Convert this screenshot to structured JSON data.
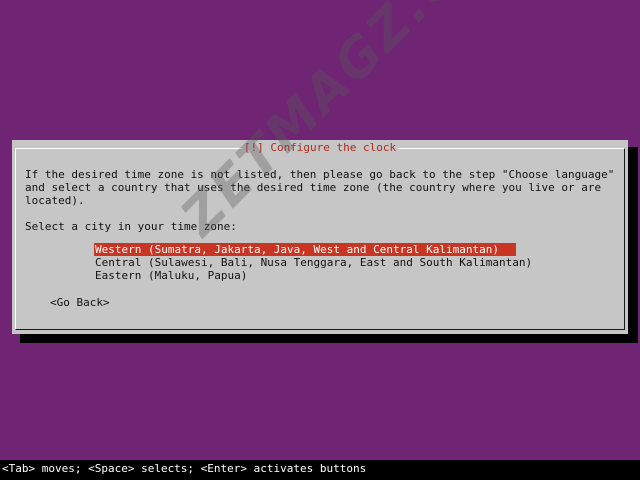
{
  "dialog": {
    "title": "[!] Configure the clock",
    "info_lines": [
      "If the desired time zone is not listed, then please go back to the step \"Choose language\"",
      "and select a country that uses the desired time zone (the country where you live or are",
      "located)."
    ],
    "prompt": "Select a city in your time zone:",
    "cities": [
      "Western (Sumatra, Jakarta, Java, West and Central Kalimantan)",
      "Central (Sulawesi, Bali, Nusa Tenggara, East and South Kalimantan)",
      "Eastern (Maluku, Papua)"
    ],
    "selected_city_index": 0,
    "go_back_label": "<Go Back>"
  },
  "help_bar": {
    "text": "<Tab> moves; <Space> selects; <Enter> activates buttons"
  },
  "watermark": {
    "text": "ZETMAGZ.COM"
  },
  "colors": {
    "background": "#6f2474",
    "dialog": "#c6c6c6",
    "title": "#b12a1a",
    "selection": "#c83522",
    "help_bar": "#000000"
  }
}
